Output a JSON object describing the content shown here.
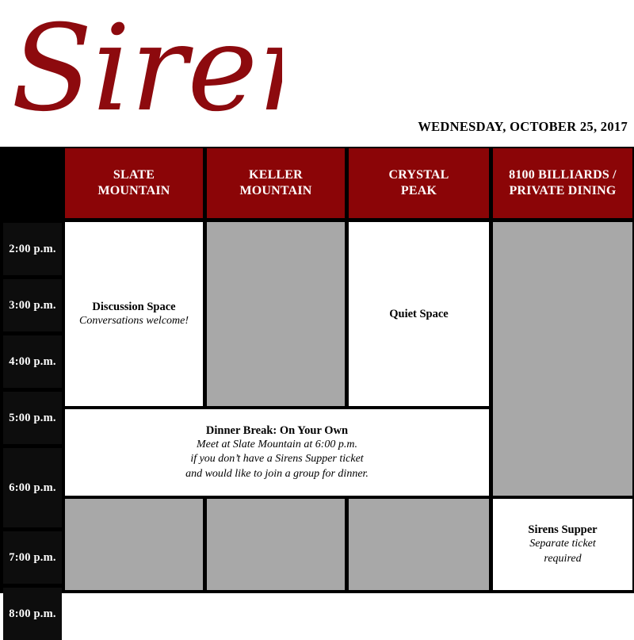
{
  "header": {
    "logo_text": "Sirens",
    "logo_color": "#8d0a0e",
    "date": "WEDNESDAY, OCTOBER 25, 2017"
  },
  "theme": {
    "header_red": "#8b0507",
    "closed_grey": "#a8a8a8",
    "open_white": "#ffffff",
    "time_black": "#0d0d0d",
    "grid_line": "#000000"
  },
  "columns": [
    {
      "id": "time",
      "label": ""
    },
    {
      "id": "slate-mountain",
      "label": "SLATE\nMOUNTAIN"
    },
    {
      "id": "keller-mountain",
      "label": "KELLER\nMOUNTAIN"
    },
    {
      "id": "crystal-peak",
      "label": "CRYSTAL\nPEAK"
    },
    {
      "id": "billiards",
      "label": "8100 BILLIARDS /\nPRIVATE DINING"
    }
  ],
  "column_labels": {
    "slate_line1": "SLATE",
    "slate_line2": "MOUNTAIN",
    "keller_line1": "KELLER",
    "keller_line2": "MOUNTAIN",
    "crystal_line1": "CRYSTAL",
    "crystal_line2": "PEAK",
    "billiards_line1": "8100 BILLIARDS /",
    "billiards_line2": "PRIVATE DINING"
  },
  "times": [
    {
      "id": "t14",
      "label": "2:00 p.m."
    },
    {
      "id": "t15",
      "label": "3:00 p.m."
    },
    {
      "id": "t16",
      "label": "4:00 p.m."
    },
    {
      "id": "t17",
      "label": "5:00 p.m."
    },
    {
      "id": "t18",
      "label": "6:00 p.m."
    },
    {
      "id": "t19",
      "label": "7:00 p.m."
    },
    {
      "id": "t20",
      "label": "8:00 p.m."
    }
  ],
  "entries": {
    "discussion": {
      "title": "Discussion Space",
      "subtitle": "Conversations welcome!"
    },
    "quiet": {
      "title": "Quiet Space"
    },
    "dinner": {
      "title": "Dinner Break: On Your Own",
      "line1": "Meet at Slate Mountain at 6:00 p.m.",
      "line2": "if you don’t have a Sirens Supper ticket",
      "line3": "and would like to join a group for dinner."
    },
    "supper": {
      "title": "Sirens Supper",
      "line1": "Separate ticket",
      "line2": "required"
    }
  }
}
